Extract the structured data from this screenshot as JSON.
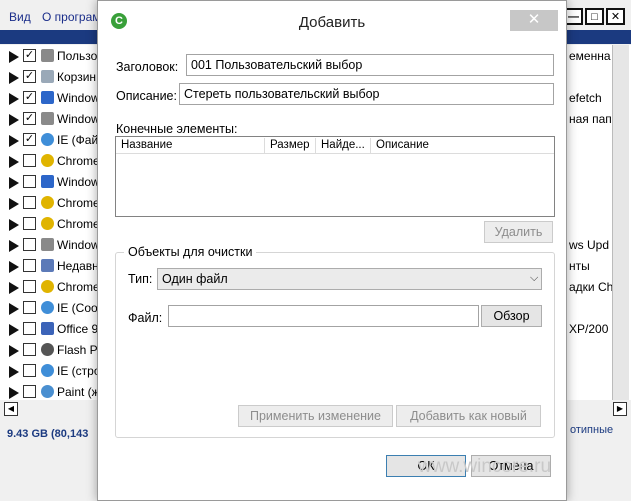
{
  "background_app": {
    "menu": [
      "Вид",
      "О программ"
    ],
    "window_buttons": [
      "—",
      "□",
      "✕"
    ],
    "rows": [
      {
        "checked": true,
        "label": "Пользо",
        "icon": "drive-icon",
        "color": "#8a8a8a"
      },
      {
        "checked": true,
        "label": "Корзин",
        "icon": "recycle-bin-icon",
        "color": "#9aa9b8"
      },
      {
        "checked": true,
        "label": "Window",
        "icon": "windows-icon",
        "color": "#2c66c9"
      },
      {
        "checked": true,
        "label": "Window",
        "icon": "drive-icon",
        "color": "#8a8a8a"
      },
      {
        "checked": true,
        "label": "IE (Фай",
        "icon": "ie-icon",
        "color": "#3f8ed8"
      },
      {
        "checked": false,
        "label": "Chrome",
        "icon": "chrome-icon",
        "color": "#e0b400"
      },
      {
        "checked": false,
        "label": "Window",
        "icon": "windows-icon",
        "color": "#2c66c9"
      },
      {
        "checked": false,
        "label": "Chrome",
        "icon": "chrome-icon",
        "color": "#e0b400"
      },
      {
        "checked": false,
        "label": "Chrome",
        "icon": "chrome-icon",
        "color": "#e0b400"
      },
      {
        "checked": false,
        "label": "Window",
        "icon": "drive-icon",
        "color": "#8a8a8a"
      },
      {
        "checked": false,
        "label": "Недавн",
        "icon": "recent-icon",
        "color": "#5c7ab8"
      },
      {
        "checked": false,
        "label": "Chrome",
        "icon": "chrome-icon",
        "color": "#e0b400"
      },
      {
        "checked": false,
        "label": "IE (Cool",
        "icon": "ie-icon",
        "color": "#3f8ed8"
      },
      {
        "checked": false,
        "label": "Office 9",
        "icon": "office-icon",
        "color": "#3b63b8"
      },
      {
        "checked": false,
        "label": "Flash Pl",
        "icon": "flash-icon",
        "color": "#555555"
      },
      {
        "checked": false,
        "label": "IE (стро",
        "icon": "ie-icon",
        "color": "#3f8ed8"
      },
      {
        "checked": false,
        "label": "Paint (ж",
        "icon": "paint-icon",
        "color": "#4a8fd0"
      }
    ],
    "right_texts": [
      {
        "row": 0,
        "text": "еменна"
      },
      {
        "row": 2,
        "text": "efetch"
      },
      {
        "row": 3,
        "text": "ная папк"
      },
      {
        "row": 9,
        "text": "ws Upd"
      },
      {
        "row": 10,
        "text": "нты"
      },
      {
        "row": 11,
        "text": "адки Ch"
      },
      {
        "row": 13,
        "text": "XP/200"
      }
    ],
    "status_left": "9.43 GB  (80,143",
    "status_right": "отипные"
  },
  "dialog": {
    "title": "Добавить",
    "close_symbol": "✕",
    "title_label": "Заголовок:",
    "title_value": "001 Пользовательский выбор",
    "description_label": "Описание:",
    "description_value": "Стереть пользовательский выбор",
    "end_elements_label": "Конечные элементы:",
    "columns": [
      "Название",
      "Размер",
      "Найде...",
      "Описание"
    ],
    "delete_button": "Удалить",
    "group_title": "Объекты для очистки",
    "type_label": "Тип:",
    "type_value": "Один файл",
    "file_label": "Файл:",
    "file_value": "",
    "browse_button": "Обзор",
    "apply_button": "Применить изменение",
    "add_new_button": "Добавить как новый",
    "ok_button": "ОК",
    "cancel_button": "Отмена",
    "watermark": "www.wincore.ru"
  }
}
